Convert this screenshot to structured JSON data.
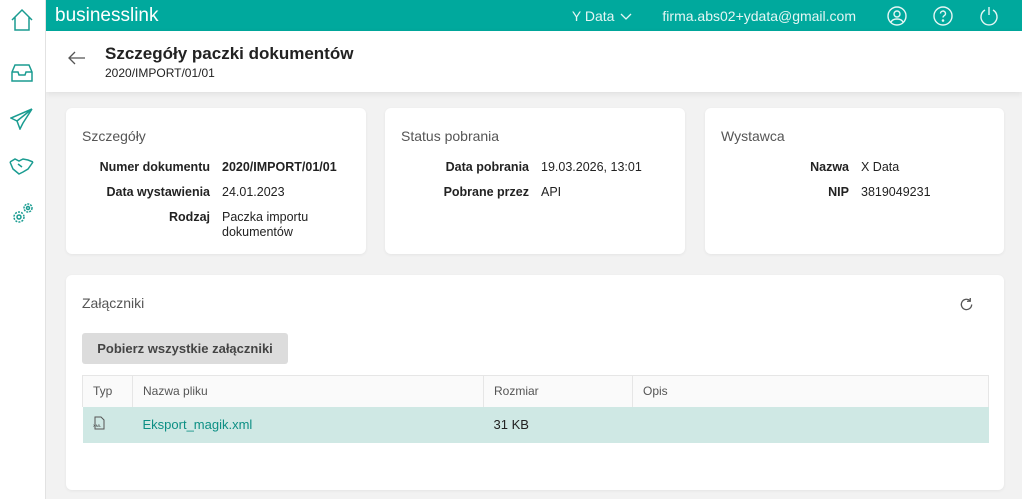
{
  "sidebar": {
    "items": [
      "home",
      "inbox",
      "send",
      "partners",
      "settings"
    ]
  },
  "topbar": {
    "brand": "businesslink",
    "company": "Y Data",
    "email": "firma.abs02+ydata@gmail.com"
  },
  "header": {
    "title": "Szczegóły paczki dokumentów",
    "subtitle": "2020/IMPORT/01/01"
  },
  "details": {
    "title": "Szczegóły",
    "rows": [
      {
        "k": "Numer dokumentu",
        "v": "2020/IMPORT/01/01"
      },
      {
        "k": "Data wystawienia",
        "v": "24.01.2023"
      },
      {
        "k": "Rodzaj",
        "v": "Paczka importu dokumentów"
      }
    ]
  },
  "status": {
    "title": "Status pobrania",
    "rows": [
      {
        "k": "Data pobrania",
        "v": "19.03.2026, 13:01"
      },
      {
        "k": "Pobrane przez",
        "v": "API"
      }
    ]
  },
  "issuer": {
    "title": "Wystawca",
    "rows": [
      {
        "k": "Nazwa",
        "v": "X Data"
      },
      {
        "k": "NIP",
        "v": "3819049231"
      }
    ]
  },
  "attachments": {
    "title": "Załączniki",
    "download_all": "Pobierz wszystkie załączniki",
    "columns": [
      "Typ",
      "Nazwa pliku",
      "Rozmiar",
      "Opis"
    ],
    "rows": [
      {
        "type": "XML",
        "name": "Eksport_magik.xml",
        "size": "31 KB",
        "desc": ""
      }
    ]
  },
  "colors": {
    "accent": "#00a99d",
    "row_selected": "#cfe8e4"
  }
}
